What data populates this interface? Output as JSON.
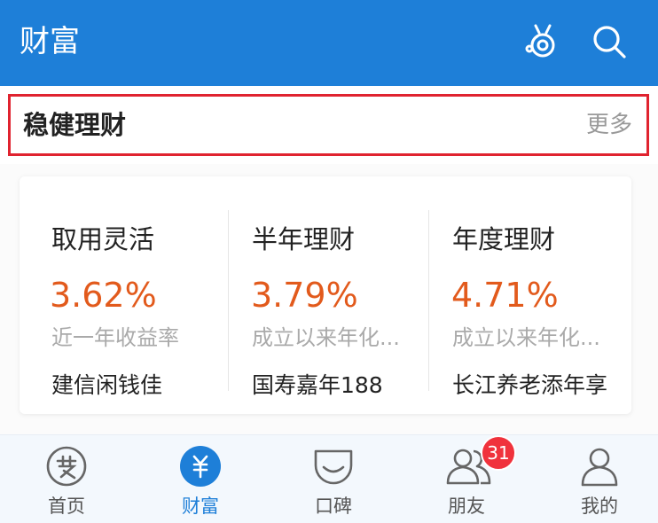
{
  "header": {
    "title": "财富",
    "background": "#1e7fd8",
    "icons": [
      "customer-service-icon",
      "search-icon"
    ]
  },
  "section": {
    "title": "稳健理财",
    "more": "更多",
    "highlight_color": "#e0232f"
  },
  "products": [
    {
      "name": "取用灵活",
      "rate": "3.62%",
      "rate_label": "近一年收益率",
      "fund": "建信闲钱佳"
    },
    {
      "name": "半年理财",
      "rate": "3.79%",
      "rate_label": "成立以来年化...",
      "fund": "国寿嘉年188"
    },
    {
      "name": "年度理财",
      "rate": "4.71%",
      "rate_label": "成立以来年化...",
      "fund": "长江养老添年享"
    }
  ],
  "rate_color": "#e25a1c",
  "tabbar": {
    "active_color": "#1e7fd8",
    "tabs": [
      {
        "label": "首页",
        "icon": "alipay-home-icon"
      },
      {
        "label": "财富",
        "icon": "yuan-wealth-icon",
        "active": true
      },
      {
        "label": "口碑",
        "icon": "koubei-icon"
      },
      {
        "label": "朋友",
        "icon": "friends-icon",
        "badge": "31"
      },
      {
        "label": "我的",
        "icon": "profile-icon"
      }
    ]
  }
}
